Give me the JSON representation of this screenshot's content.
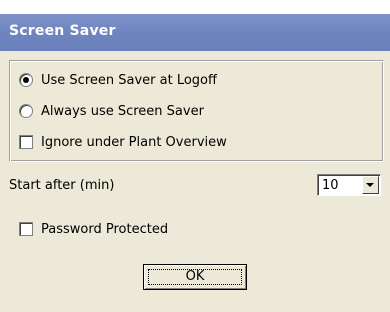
{
  "window": {
    "title": "Screen Saver"
  },
  "options": {
    "use_at_logoff": "Use Screen Saver at Logoff",
    "always_use": "Always use Screen Saver",
    "ignore_plant_overview": "Ignore under Plant Overview",
    "selected": "use_at_logoff",
    "ignore_plant_overview_checked": false
  },
  "start_after": {
    "label": "Start after (min)",
    "value": "10"
  },
  "password": {
    "label": "Password Protected",
    "checked": false
  },
  "buttons": {
    "ok": "OK"
  },
  "colors": {
    "titlebar": "#7387c2",
    "dialog_bg": "#ece9d8"
  }
}
